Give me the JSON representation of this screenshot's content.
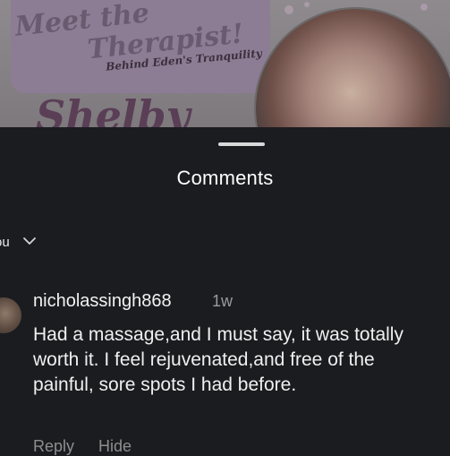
{
  "post": {
    "title_line1": "Meet the",
    "title_line2": "Therapist!",
    "subtitle": "Behind Eden's Tranquility",
    "name_partial": "Shelby"
  },
  "sheet": {
    "title": "Comments",
    "sort_label": "ou"
  },
  "comments": [
    {
      "username": "nicholassingh868",
      "time": "1w",
      "text": "Had a massage,and I must say, it was totally worth it. I feel rejuvenated,and free of the painful, sore spots I had before.",
      "reply_label": "Reply",
      "hide_label": "Hide"
    }
  ],
  "icons": {
    "sort": "chevron-down-icon"
  },
  "colors": {
    "sheet_bg": "#1b1c20",
    "text_primary": "#f0f0f0",
    "text_secondary": "#9b9b9b"
  }
}
